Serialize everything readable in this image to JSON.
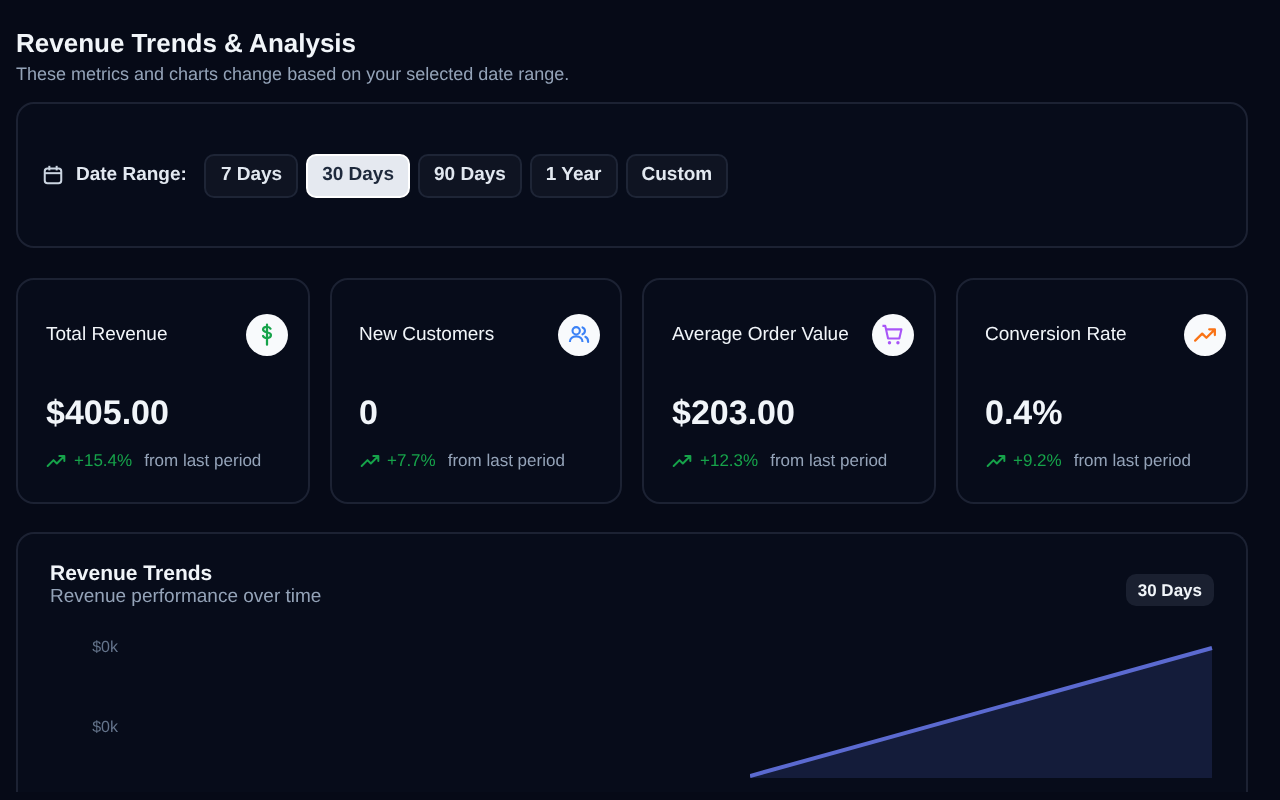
{
  "header": {
    "title": "Revenue Trends & Analysis",
    "subtitle": "These metrics and charts change based on your selected date range."
  },
  "date_range": {
    "label": "Date Range:",
    "options": [
      {
        "label": "7 Days",
        "selected": false
      },
      {
        "label": "30 Days",
        "selected": true
      },
      {
        "label": "90 Days",
        "selected": false
      },
      {
        "label": "1 Year",
        "selected": false
      },
      {
        "label": "Custom",
        "selected": false
      }
    ]
  },
  "metrics": [
    {
      "title": "Total Revenue",
      "kind": "dollar",
      "value": "$405.00",
      "change": "+15.4%",
      "note": "from last period"
    },
    {
      "title": "New Customers",
      "kind": "users",
      "value": "0",
      "change": "+7.7%",
      "note": "from last period"
    },
    {
      "title": "Average Order Value",
      "kind": "cart",
      "value": "$203.00",
      "change": "+12.3%",
      "note": "from last period"
    },
    {
      "title": "Conversion Rate",
      "kind": "trend",
      "value": "0.4%",
      "change": "+9.2%",
      "note": "from last period"
    }
  ],
  "revenue_chart": {
    "title": "Revenue Trends",
    "subtitle": "Revenue performance over time",
    "badge": "30 Days",
    "y_tick_labels": [
      "$0k",
      "$0k"
    ]
  }
}
